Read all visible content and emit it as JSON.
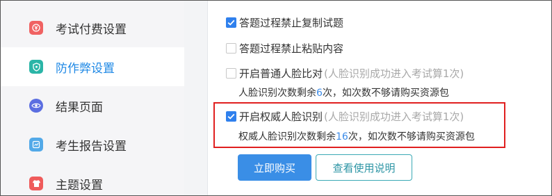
{
  "sidebar": {
    "items": [
      {
        "label": "考试付费设置",
        "icon": "payment-icon",
        "color": "#f06262"
      },
      {
        "label": "防作弊设置",
        "icon": "shield-icon",
        "color": "#2bb5a7"
      },
      {
        "label": "结果页面",
        "icon": "eye-icon",
        "color": "#5b6ee1"
      },
      {
        "label": "考生报告设置",
        "icon": "report-icon",
        "color": "#52a9e8"
      },
      {
        "label": "主题设置",
        "icon": "shirt-icon",
        "color": "#ef5b5b"
      }
    ],
    "active_index": 1
  },
  "options": {
    "no_copy": {
      "label": "答题过程禁止复制试题",
      "checked": true
    },
    "no_paste": {
      "label": "答题过程禁止粘贴内容",
      "checked": false
    },
    "face_compare": {
      "label": "开启普通人脸比对",
      "hint": "(人脸识别成功进入考试算1次)",
      "checked": false,
      "info_prefix": "人脸识别次数剩余",
      "count": "6",
      "info_suffix": "次，如次数不够请购买资源包"
    },
    "auth_face": {
      "label": "开启权威人脸识别",
      "hint": "(人脸识别成功进入考试算1次)",
      "checked": true,
      "info_prefix": "权威人脸识别次数剩余",
      "count": "16",
      "info_suffix": "次，如次数不够请购买资源包"
    }
  },
  "buttons": {
    "buy_now": "立即购买",
    "view_instructions": "查看使用说明"
  },
  "colors": {
    "accent": "#2f80ed",
    "highlight_border": "#e01f1f"
  }
}
